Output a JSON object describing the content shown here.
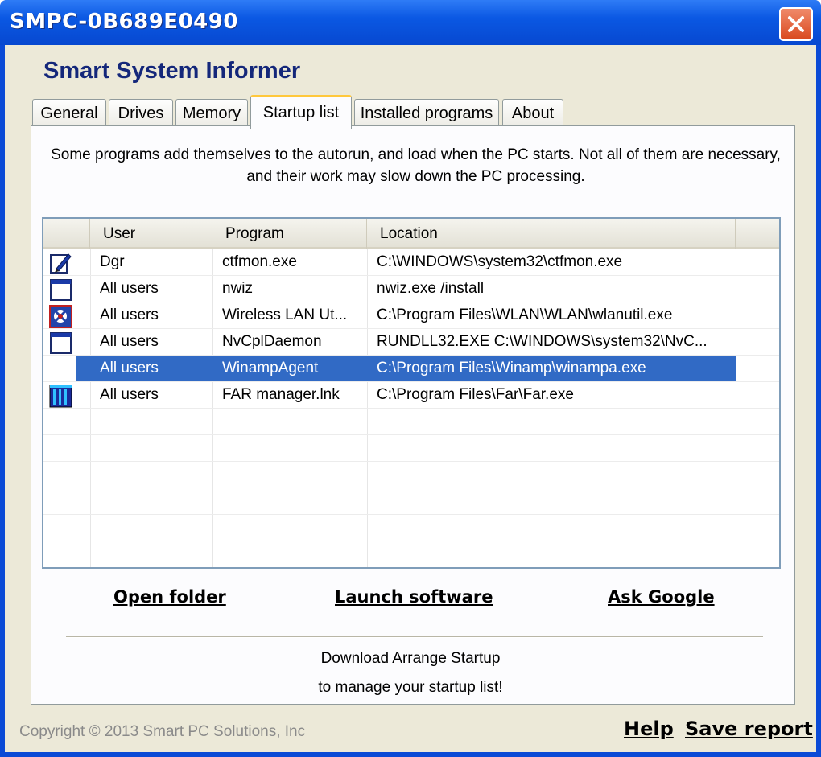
{
  "window": {
    "title": "SMPC-0B689E0490"
  },
  "app": {
    "title": "Smart System Informer"
  },
  "tabs": [
    {
      "label": "General"
    },
    {
      "label": "Drives"
    },
    {
      "label": "Memory"
    },
    {
      "label": "Startup list"
    },
    {
      "label": "Installed programs"
    },
    {
      "label": "About"
    }
  ],
  "active_tab": "Startup list",
  "description": "Some programs add themselves to the autorun, and load when the PC starts. Not all of them are necessary, and their work may slow down the PC processing.",
  "table": {
    "columns": [
      "User",
      "Program",
      "Location"
    ],
    "rows": [
      {
        "icon": "notepad-pen-icon",
        "user": "Dgr",
        "program": "ctfmon.exe",
        "location": "C:\\WINDOWS\\system32\\ctfmon.exe"
      },
      {
        "icon": "window-app-icon",
        "user": "All users",
        "program": "nwiz",
        "location": "nwiz.exe /install"
      },
      {
        "icon": "wireless-network-icon",
        "user": "All users",
        "program": "Wireless LAN Ut...",
        "location": "C:\\Program Files\\WLAN\\WLAN\\wlanutil.exe"
      },
      {
        "icon": "window-app-icon",
        "user": "All users",
        "program": "NvCplDaemon",
        "location": "RUNDLL32.EXE C:\\WINDOWS\\system32\\NvC..."
      },
      {
        "icon": "",
        "user": "All users",
        "program": "WinampAgent",
        "location": "C:\\Program Files\\Winamp\\winampa.exe",
        "selected": true
      },
      {
        "icon": "far-manager-icon",
        "user": "All users",
        "program": "FAR manager.lnk",
        "location": "C:\\Program Files\\Far\\Far.exe"
      }
    ]
  },
  "actions": {
    "open_folder": "Open folder",
    "launch_software": "Launch software",
    "ask_google": "Ask Google"
  },
  "promo": {
    "link": "Download Arrange Startup",
    "subtitle": "to manage your startup list!"
  },
  "footer": {
    "copyright": "Copyright © 2013 Smart PC Solutions, Inc",
    "help": "Help",
    "save_report": "Save report"
  },
  "colors": {
    "titlebar": "#0b58e3",
    "selection": "#316ac5",
    "app_title": "#14277a",
    "window_bg": "#ece9d8",
    "tab_highlight": "#ffc83c"
  }
}
